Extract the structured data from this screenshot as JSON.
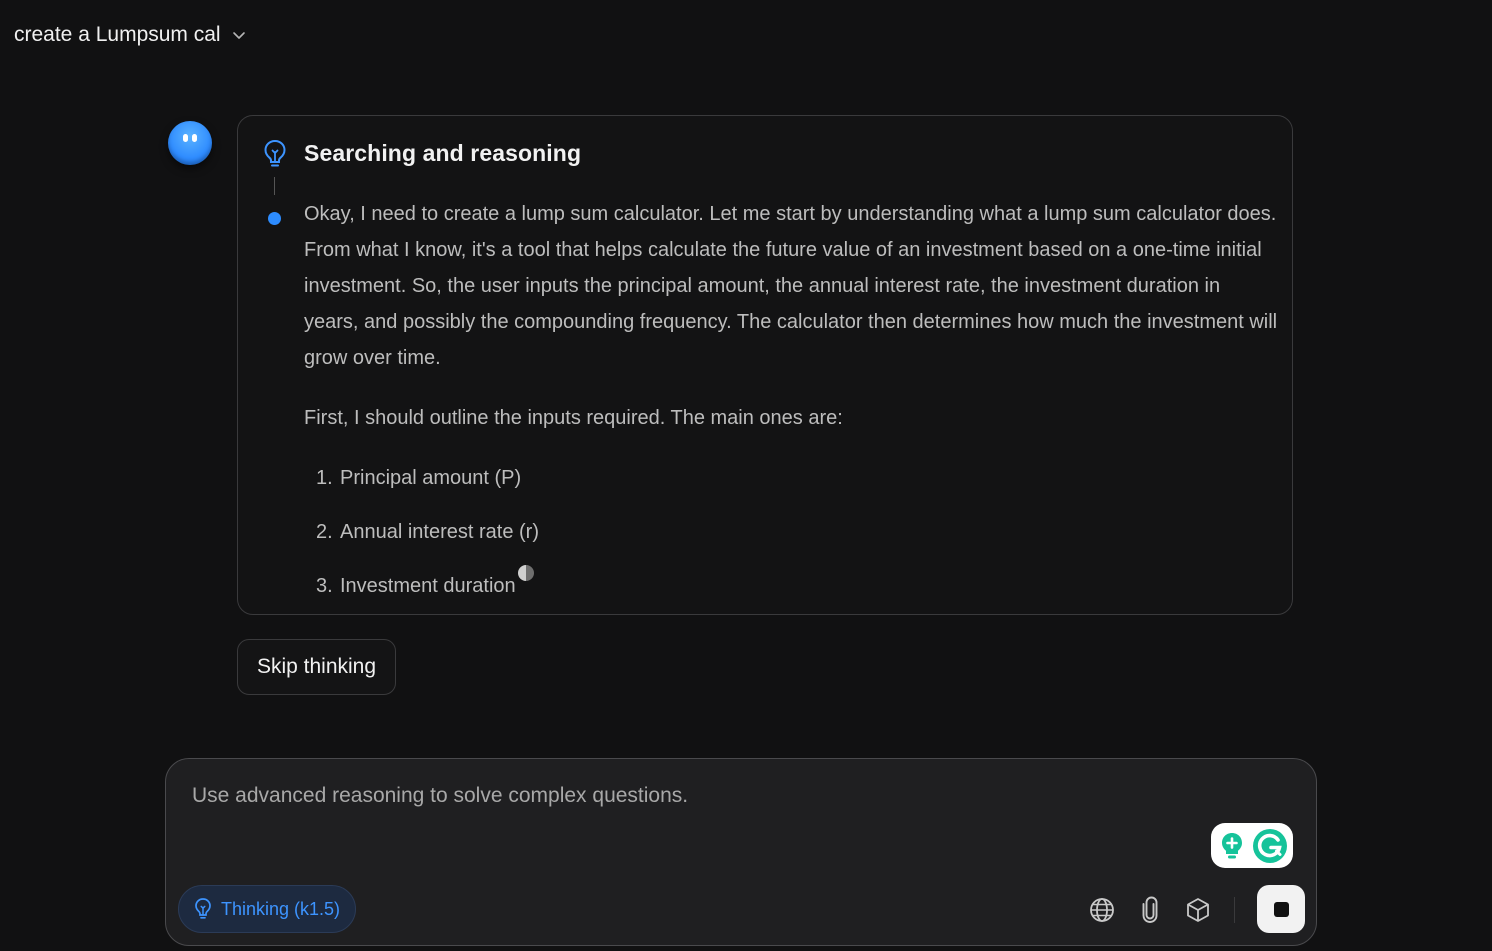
{
  "header": {
    "title": "create a Lumpsum cal",
    "dropdown_icon": "chevron-down-icon"
  },
  "thinking": {
    "heading": "Searching and reasoning",
    "icon": "lightbulb-icon",
    "paragraph1": "Okay, I need to create a lump sum calculator. Let me start by understanding what a lump sum calculator does. From what I know, it's a tool that helps calculate the future value of an investment based on a one-time initial investment. So, the user inputs the principal amount, the annual interest rate, the investment duration in years, and possibly the compounding frequency. The calculator then determines how much the investment will grow over time.",
    "paragraph2": "First, I should outline the inputs required. The main ones are:",
    "list": [
      {
        "num": "1.",
        "text": "Principal amount (P)"
      },
      {
        "num": "2.",
        "text": "Annual interest rate (r)"
      },
      {
        "num": "3.",
        "text": "Investment duration"
      }
    ]
  },
  "skip_button": {
    "label": "Skip thinking"
  },
  "composer": {
    "placeholder": "Use advanced reasoning to solve complex questions.",
    "value": "",
    "mode_chip": {
      "label": "Thinking (k1.5)",
      "icon": "lightbulb-icon"
    },
    "tools": [
      "globe-icon",
      "paperclip-icon",
      "cube-icon"
    ],
    "stop_icon": "stop-icon",
    "extension_icons": [
      "grammarly-bulb-icon",
      "grammarly-g-icon"
    ]
  },
  "colors": {
    "background": "#111112",
    "accent": "#2d8cff",
    "grammarly_green": "#15c39a"
  }
}
